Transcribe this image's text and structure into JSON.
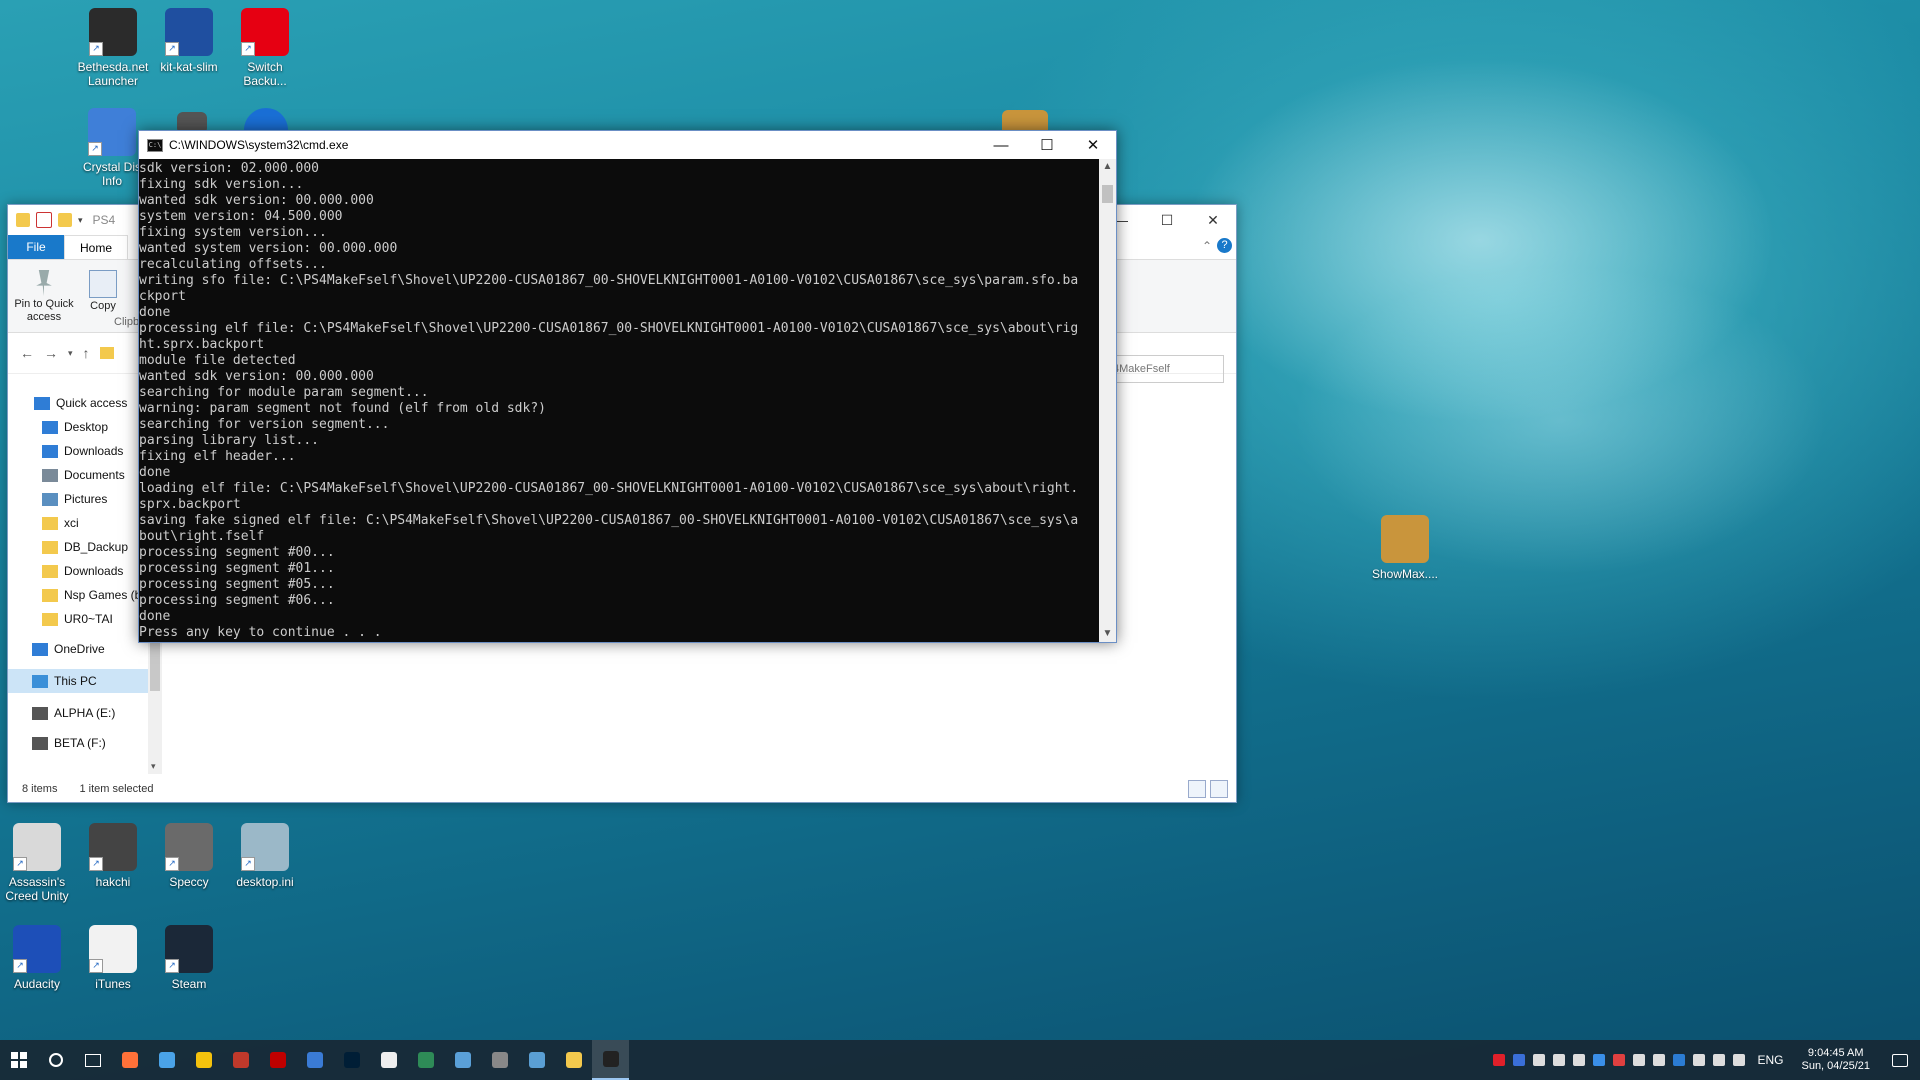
{
  "desktop": {
    "icons_top": [
      {
        "label": "Bethesda.net Launcher",
        "color": "#2b2b2b"
      },
      {
        "label": "kit-kat-slim",
        "color": "#1f4fa0"
      },
      {
        "label": "Switch Backu...",
        "color": "#e60012"
      }
    ],
    "icon_crystal": {
      "label": "Crystal Dis Info",
      "color": "#3f7fd8"
    },
    "icon_showmax": {
      "label": "ShowMax....",
      "color": "#c9953c"
    },
    "icons_bottom_row1": [
      {
        "label": "Assassin's Creed Unity",
        "color": "#d9d9d9"
      },
      {
        "label": "hakchi",
        "color": "#444444"
      },
      {
        "label": "Speccy",
        "color": "#6a6a6a"
      },
      {
        "label": "desktop.ini",
        "color": "#9bb8c8"
      }
    ],
    "icons_bottom_row2": [
      {
        "label": "Audacity",
        "color": "#1d4fb8"
      },
      {
        "label": "iTunes",
        "color": "#f2f2f2"
      },
      {
        "label": "Steam",
        "color": "#1b2838"
      }
    ]
  },
  "explorer": {
    "path_partial": "PS4",
    "tabs": {
      "file": "File",
      "home": "Home"
    },
    "ribbon": {
      "pin": "Pin to Quick access",
      "copy": "Copy",
      "clipboard_partial": "Clipb"
    },
    "search_partial": "4MakeFself",
    "nav": [
      {
        "label": "Quick access",
        "color": "#2f7dd6"
      },
      {
        "label": "Desktop",
        "color": "#2f7dd6"
      },
      {
        "label": "Downloads",
        "color": "#2f7dd6"
      },
      {
        "label": "Documents",
        "color": "#7a8a99"
      },
      {
        "label": "Pictures",
        "color": "#5a8fc0"
      },
      {
        "label": "xci",
        "color": "#f3c94d"
      },
      {
        "label": "DB_Dackup",
        "color": "#f3c94d"
      },
      {
        "label": "Downloads",
        "color": "#f3c94d"
      },
      {
        "label": "Nsp Games (b",
        "color": "#f3c94d"
      },
      {
        "label": "UR0~TAI",
        "color": "#f3c94d"
      },
      {
        "label": "OneDrive",
        "color": "#2f7dd6"
      },
      {
        "label": "This PC",
        "color": "#3a8fd8"
      },
      {
        "label": "ALPHA (E:)",
        "color": "#555555"
      },
      {
        "label": "BETA (F:)",
        "color": "#555555"
      }
    ],
    "status": {
      "items": "8 items",
      "selected": "1 item selected"
    }
  },
  "cmd": {
    "title": "C:\\WINDOWS\\system32\\cmd.exe",
    "lines": [
      "sdk version: 02.000.000",
      "fixing sdk version...",
      "wanted sdk version: 00.000.000",
      "system version: 04.500.000",
      "fixing system version...",
      "wanted system version: 00.000.000",
      "recalculating offsets...",
      "writing sfo file: C:\\PS4MakeFself\\Shovel\\UP2200-CUSA01867_00-SHOVELKNIGHT0001-A0100-V0102\\CUSA01867\\sce_sys\\param.sfo.ba",
      "ckport",
      "done",
      "processing elf file: C:\\PS4MakeFself\\Shovel\\UP2200-CUSA01867_00-SHOVELKNIGHT0001-A0100-V0102\\CUSA01867\\sce_sys\\about\\rig",
      "ht.sprx.backport",
      "module file detected",
      "wanted sdk version: 00.000.000",
      "searching for module param segment...",
      "warning: param segment not found (elf from old sdk?)",
      "searching for version segment...",
      "parsing library list...",
      "fixing elf header...",
      "done",
      "loading elf file: C:\\PS4MakeFself\\Shovel\\UP2200-CUSA01867_00-SHOVELKNIGHT0001-A0100-V0102\\CUSA01867\\sce_sys\\about\\right.",
      "sprx.backport",
      "saving fake signed elf file: C:\\PS4MakeFself\\Shovel\\UP2200-CUSA01867_00-SHOVELKNIGHT0001-A0100-V0102\\CUSA01867\\sce_sys\\a",
      "bout\\right.fself",
      "processing segment #00...",
      "processing segment #01...",
      "processing segment #05...",
      "processing segment #06...",
      "done",
      "Press any key to continue . . ."
    ]
  },
  "taskbar": {
    "pinned": [
      {
        "name": "start",
        "color": "#ffffff"
      },
      {
        "name": "search",
        "color": "#ffffff"
      },
      {
        "name": "task-view",
        "color": "#ffffff"
      },
      {
        "name": "firefox",
        "color": "#ff7139"
      },
      {
        "name": "app-blue",
        "color": "#4aa3e8"
      },
      {
        "name": "chrome",
        "color": "#f4c20d"
      },
      {
        "name": "app-red",
        "color": "#c0392b"
      },
      {
        "name": "filezilla",
        "color": "#bf0000"
      },
      {
        "name": "monitor",
        "color": "#3a7bd5"
      },
      {
        "name": "photoshop",
        "color": "#001e36"
      },
      {
        "name": "excel-x",
        "color": "#eeeeee"
      },
      {
        "name": "app-green",
        "color": "#2e8b57"
      },
      {
        "name": "network",
        "color": "#5aa0d8"
      },
      {
        "name": "calculator",
        "color": "#888888"
      },
      {
        "name": "photos",
        "color": "#5a9fd4"
      },
      {
        "name": "file-explorer",
        "color": "#f3c94d"
      },
      {
        "name": "cmd",
        "color": "#222222"
      }
    ],
    "tray": [
      {
        "name": "m-app",
        "color": "#e0202a"
      },
      {
        "name": "app-blue",
        "color": "#3a6fd8"
      },
      {
        "name": "mail",
        "color": "#dddddd"
      },
      {
        "name": "app-white",
        "color": "#dddddd"
      },
      {
        "name": "usb",
        "color": "#dddddd"
      },
      {
        "name": "bluetooth",
        "color": "#3a8fe8"
      },
      {
        "name": "app-red",
        "color": "#e04040"
      },
      {
        "name": "app-white2",
        "color": "#dddddd"
      },
      {
        "name": "shield",
        "color": "#dddddd"
      },
      {
        "name": "word",
        "color": "#2b7cd3"
      },
      {
        "name": "battery",
        "color": "#dddddd"
      },
      {
        "name": "wifi",
        "color": "#dddddd"
      },
      {
        "name": "volume",
        "color": "#dddddd"
      }
    ],
    "lang": "ENG",
    "time": "9:04:45 AM",
    "date": "Sun, 04/25/21"
  }
}
